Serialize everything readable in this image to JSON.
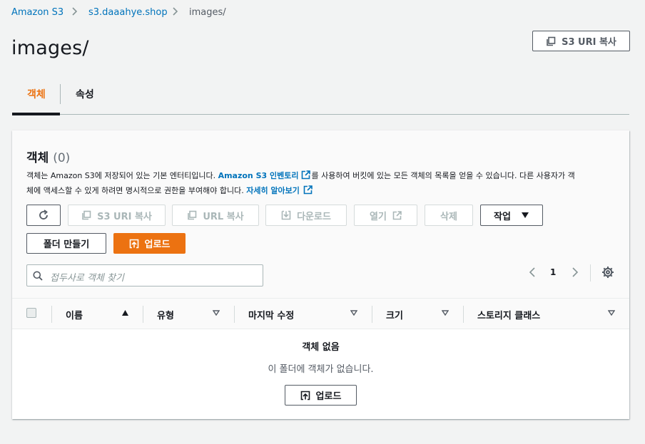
{
  "breadcrumb": {
    "items": [
      "Amazon S3",
      "s3.daaahye.shop",
      "images/"
    ]
  },
  "page": {
    "title": "images/",
    "copy_uri_button": "S3 URI 복사"
  },
  "tabs": [
    {
      "label": "객체",
      "active": true
    },
    {
      "label": "속성",
      "active": false
    }
  ],
  "objects_panel": {
    "title": "객체",
    "count": "(0)",
    "desc_line1_a": "객체는 Amazon S3에 저장되어 있는 기본 엔터티입니다. ",
    "desc_link1": "Amazon S3 인벤토리",
    "desc_line1_b": "를 사용하여 버킷에 있는 모든 객체의 목록을 얻을 수 있습니다. 다른 사용자가 객",
    "desc_line2_a": "체에 액세스할 수 있게 하려면 명시적으로 권한을 부여해야 합니다. ",
    "desc_link2": "자세히 알아보기",
    "actions": {
      "refresh": "refresh-icon",
      "copy_s3_uri": "S3 URI 복사",
      "copy_url": "URL 복사",
      "download": "다운로드",
      "open": "열기",
      "delete": "삭제",
      "actions_menu": "작업",
      "create_folder": "폴더 만들기",
      "upload": "업로드"
    },
    "search": {
      "placeholder": "접두사로 객체 찾기",
      "value": ""
    },
    "pagination": {
      "current_page": "1"
    },
    "table": {
      "columns": [
        "이름",
        "유형",
        "마지막 수정",
        "크기",
        "스토리지 클래스"
      ],
      "rows": []
    },
    "empty_state": {
      "title": "객체 없음",
      "message": "이 폴더에 객체가 없습니다.",
      "upload_button": "업로드"
    }
  },
  "colors": {
    "link": "#0073bb",
    "primary": "#ec7211",
    "active_tab": "#ec7211",
    "text": "#16191f",
    "muted": "#545b64",
    "disabled": "#aab7b8"
  }
}
